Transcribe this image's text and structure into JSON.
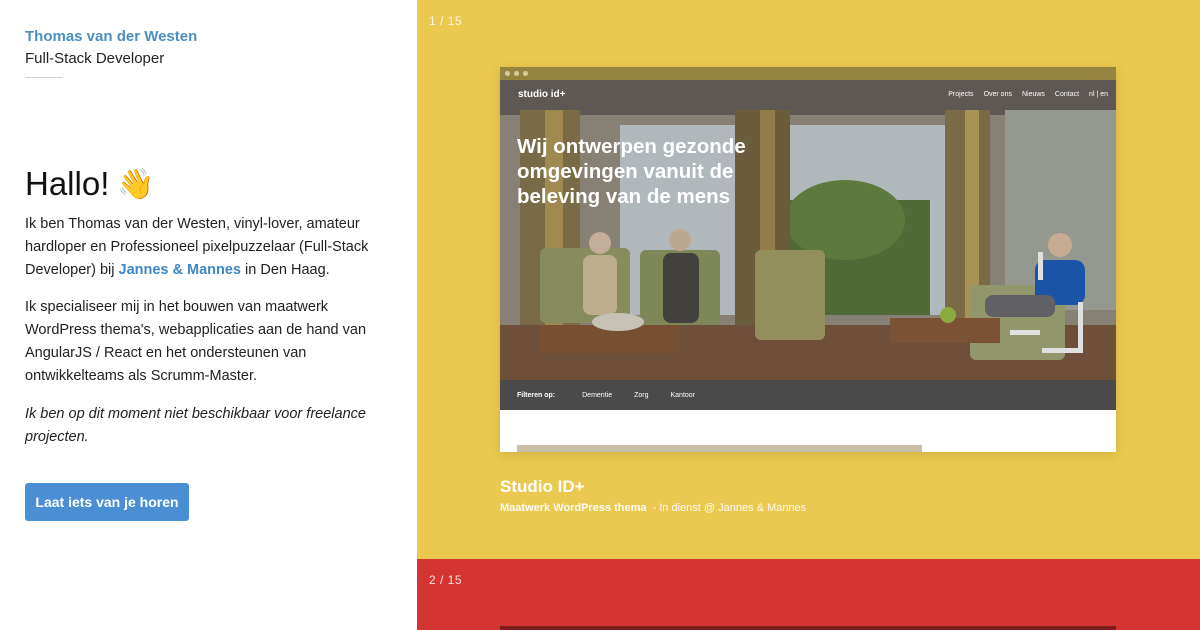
{
  "profile": {
    "name": "Thomas van der Westen",
    "role": "Full-Stack Developer"
  },
  "intro": {
    "greeting": "Hallo!",
    "wave_icon": "waving-hand-icon",
    "p1_before": "Ik ben Thomas van der Westen, vinyl-lover, amateur hardloper en Professioneel pixelpuzzelaar (Full-Stack Developer) bij ",
    "p1_link": "Jannes & Mannes",
    "p1_after": " in Den Haag.",
    "p2": "Ik specialiseer mij in het bouwen van maatwerk WordPress thema's, webapplicaties aan de hand van AngularJS / React en het ondersteunen van ontwikkelteams als Scrumm-Master.",
    "p3": "Ik ben op dit moment niet beschikbaar voor freelance projecten.",
    "cta": "Laat iets van je horen"
  },
  "slides": [
    {
      "counter": "1 / 15",
      "background": "#ebc84f",
      "site": {
        "logo": "studio id+",
        "nav": [
          "Projects",
          "Over ons",
          "Nieuws",
          "Contact",
          "nl | en"
        ],
        "headline": "Wij ontwerpen gezonde omgevingen vanuit de beleving van de mens",
        "filter_label": "Filteren op:",
        "filters": [
          "Dementie",
          "Zorg",
          "Kantoor"
        ]
      },
      "title": "Studio ID+",
      "meta_type": "Maatwerk WordPress thema",
      "meta_context": "- In dienst @ Jannes & Mannes"
    },
    {
      "counter": "2 / 15",
      "background": "#d43533"
    }
  ]
}
